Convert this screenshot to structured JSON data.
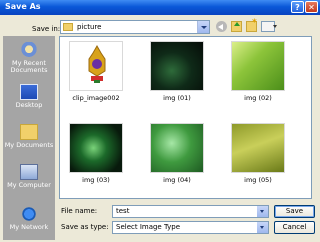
{
  "window": {
    "title": "Save As",
    "help_label": "?",
    "close_label": "✕"
  },
  "toolbar": {
    "save_in_label": "Save in:",
    "save_in_value": "picture",
    "icons": [
      "back-icon",
      "up-folder-icon",
      "new-folder-icon",
      "views-menu-icon"
    ]
  },
  "places": [
    {
      "label": "My Recent Documents",
      "icon": "recent-documents-icon"
    },
    {
      "label": "Desktop",
      "icon": "desktop-icon"
    },
    {
      "label": "My Documents",
      "icon": "my-documents-icon"
    },
    {
      "label": "My Computer",
      "icon": "my-computer-icon"
    },
    {
      "label": "My Network",
      "icon": "my-network-icon"
    }
  ],
  "files": [
    {
      "name": "clip_image002"
    },
    {
      "name": "img (01)"
    },
    {
      "name": "img (02)"
    },
    {
      "name": "img (03)"
    },
    {
      "name": "img (04)"
    },
    {
      "name": "img (05)"
    }
  ],
  "footer": {
    "file_name_label": "File name:",
    "file_name_value": "test",
    "save_as_type_label": "Save as type:",
    "save_as_type_value": "Select Image Type",
    "save_button": "Save",
    "cancel_button": "Cancel"
  },
  "colors": {
    "title_bar": "#0a58d8",
    "dialog_bg": "#ece9d8",
    "places_bar": "#a5a5a5"
  }
}
